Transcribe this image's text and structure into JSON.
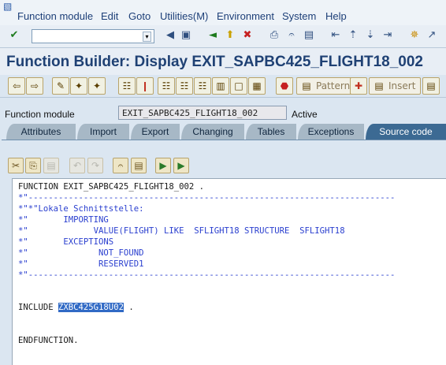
{
  "menubar": {
    "items": [
      "Function module",
      "Edit",
      "Goto",
      "Utilities(M)",
      "Environment",
      "System",
      "Help"
    ]
  },
  "title": "Function Builder: Display EXIT_SAPBC425_FLIGHT18_002",
  "app_toolbar": {
    "pattern_label": "Pattern",
    "insert_label": "Insert"
  },
  "header": {
    "fm_label": "Function module",
    "fm_value": "EXIT_SAPBC425_FLIGHT18_002",
    "status": "Active"
  },
  "tabs": [
    "Attributes",
    "Import",
    "Export",
    "Changing",
    "Tables",
    "Exceptions",
    "Source code"
  ],
  "active_tab": "Source code",
  "code": {
    "l1": "FUNCTION EXIT_SAPBC425_FLIGHT18_002 .",
    "l2": "*\"-------------------------------------------------------------------------",
    "l3": "*\"*\"Lokale Schnittstelle:",
    "l4": "*\"       IMPORTING",
    "l5": "*\"             VALUE(FLIGHT) LIKE  SFLIGHT18 STRUCTURE  SFLIGHT18",
    "l6": "*\"       EXCEPTIONS",
    "l7": "*\"              NOT_FOUND",
    "l8": "*\"              RESERVED1",
    "l9": "*\"-------------------------------------------------------------------------",
    "include_keyword": "INCLUDE ",
    "include_name": "ZXBC425G18U02",
    "include_end": " .",
    "endfunction": "ENDFUNCTION."
  }
}
